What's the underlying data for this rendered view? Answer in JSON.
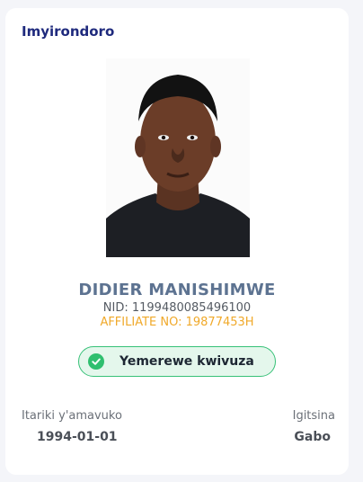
{
  "profile": {
    "title": "Imyirondoro",
    "photo_icon": "profile-photo",
    "name": "DIDIER MANISHIMWE",
    "nid": "NID: 1199480085496100",
    "affiliate": "AFFILIATE NO: 19877453H",
    "status": {
      "label": "Yemerewe kwivuza",
      "icon": "check-circle-icon",
      "color": "#2fbf6f"
    },
    "birth_date": {
      "label": "Itariki y'amavuko",
      "value": "1994-01-01"
    },
    "gender": {
      "label": "Igitsina",
      "value": "Gabo"
    }
  },
  "colors": {
    "title": "#1f2a7d",
    "name": "#5d7391",
    "affiliate": "#f0a92a",
    "badge_background": "#e4f7ec",
    "badge_border": "#37c178"
  }
}
